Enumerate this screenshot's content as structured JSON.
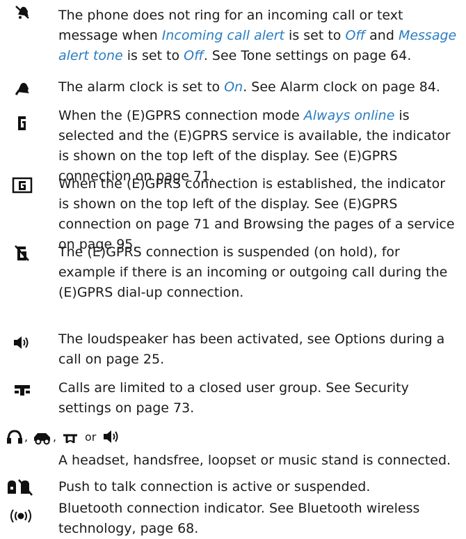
{
  "entries": [
    {
      "icon": "bell-off-icon",
      "parts": [
        "The phone does not ring for an incoming call or text message when ",
        "Incoming call alert",
        " is set to ",
        "Off",
        " and ",
        "Message alert tone",
        " is set to ",
        "Off",
        ". See Tone settings on page 64."
      ]
    },
    {
      "icon": "alarm-bell-icon",
      "parts": [
        "The alarm clock is set to ",
        "On",
        ". See Alarm clock on page 84."
      ]
    },
    {
      "icon": "gprs-letter-icon",
      "parts": [
        "When the (E)GPRS connection mode ",
        "Always online",
        " is selected and the (E)GPRS service is available, the indicator is shown on the top left of the display. See (E)GPRS connection on page 71."
      ]
    },
    {
      "icon": "gprs-boxed-icon",
      "parts": [
        "When the (E)GPRS connection is established, the indicator is shown on the top left of the display. See (E)GPRS connection on page 71 and Browsing the pages of a service on page 95."
      ]
    },
    {
      "icon": "gprs-suspended-icon",
      "parts": [
        "The (E)GPRS connection is suspended (on hold), for example if there is an incoming or outgoing call during the (E)GPRS dial-up connection."
      ]
    },
    {
      "icon": "loudspeaker-icon",
      "parts": [
        "The loudspeaker has been activated, see Options during a call on page 25."
      ]
    },
    {
      "icon": "closed-user-group-icon",
      "parts": [
        "Calls are limited to a closed user group. See Security settings on page 73."
      ]
    },
    {
      "icon": "accessory-icons",
      "sep1": ",",
      "sep2": ",",
      "or": "or",
      "parts": [
        "A headset, handsfree, loopset or music stand is connected."
      ]
    },
    {
      "icon": "ptt-icon",
      "parts": [
        "Push to talk connection is active or suspended."
      ]
    },
    {
      "icon": "bluetooth-icon",
      "parts": [
        "Bluetooth connection indicator. See Bluetooth wireless technology, page 68."
      ]
    }
  ]
}
